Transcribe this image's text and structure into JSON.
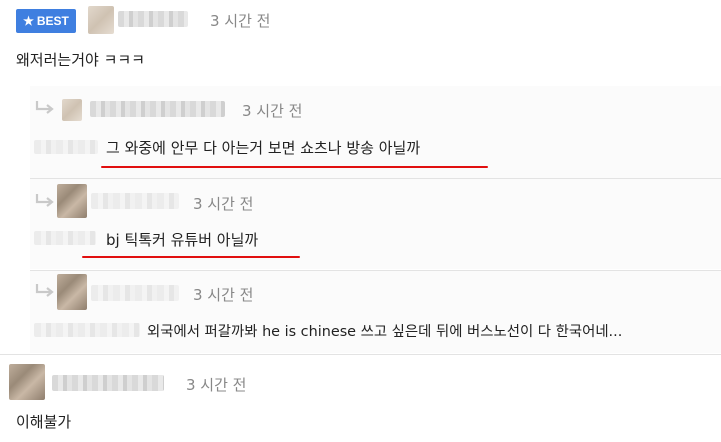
{
  "best_comment": {
    "badge_label": "BEST",
    "time": "3 시간 전",
    "body": "왜저러는거야 ㅋㅋㅋ"
  },
  "replies": [
    {
      "time": "3 시간 전",
      "body": "그 와중에 안무 다 아는거 보면 쇼츠나 방송 아닐까"
    },
    {
      "time": "3 시간 전",
      "body": "bj 틱톡커 유튜버 아닐까"
    },
    {
      "time": "3 시간 전",
      "body": "외국에서 퍼갈까봐 he is chinese 쓰고 싶은데 뒤에 버스노선이 다 한국어네..."
    }
  ],
  "bottom_comment": {
    "time": "3 시간 전",
    "body": "이해불가"
  },
  "colors": {
    "badge": "#3f7fe0",
    "underline": "#e10f0f",
    "time_text": "#888888"
  },
  "icons": [
    "star-icon",
    "reply-arrow-icon"
  ]
}
